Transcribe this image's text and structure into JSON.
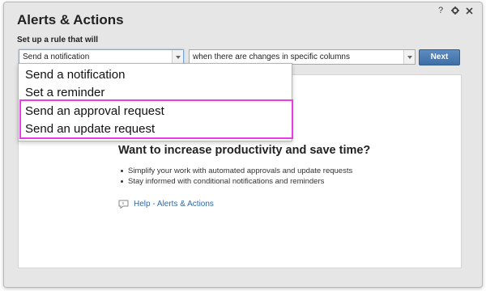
{
  "dialog": {
    "title": "Alerts & Actions",
    "title_bar": {
      "help": "?",
      "settings": "settings-icon",
      "close": "close-icon"
    }
  },
  "rule": {
    "label": "Set up a rule that will",
    "action_select": {
      "value": "Send a notification"
    },
    "condition_select": {
      "value": "when there are changes in specific columns"
    },
    "next_label": "Next"
  },
  "dropdown": {
    "items": [
      "Send a notification",
      "Set a reminder",
      "Send an approval request",
      "Send an update request"
    ],
    "highlight_color": "#e83ce6"
  },
  "promo": {
    "heading": "Want to increase productivity and save time?",
    "bullets": [
      "Simplify your work with automated approvals and update requests",
      "Stay informed with conditional notifications and reminders"
    ],
    "help_link": "Help - Alerts & Actions"
  },
  "colors": {
    "accent": "#3d6ea6",
    "link": "#2f6aa8",
    "dialog_bg": "#e6e6e6"
  }
}
